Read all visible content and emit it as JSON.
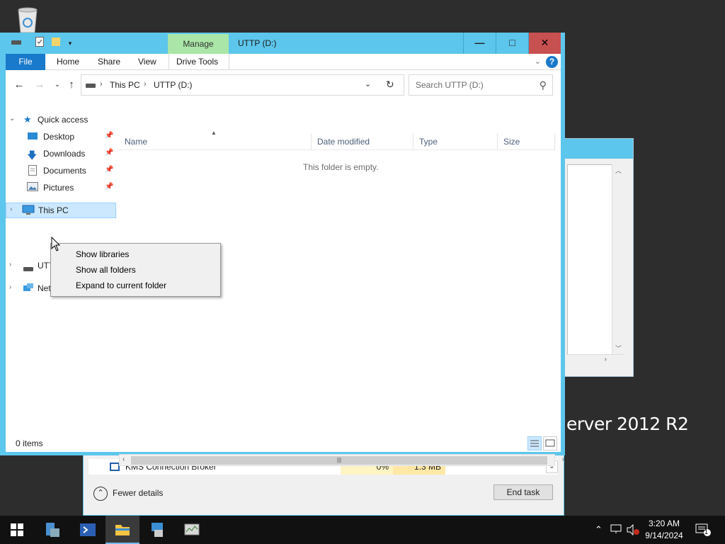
{
  "desktop": {
    "recycle_bin_icon": "recycle-bin-icon",
    "watermark": "erver 2012 R2"
  },
  "explorer": {
    "title": "UTTP (D:)",
    "manage_tab": "Manage",
    "ribbon_tabs": [
      "File",
      "Home",
      "Share",
      "View",
      "Drive Tools"
    ],
    "breadcrumb": [
      "This PC",
      "UTTP (D:)"
    ],
    "search_placeholder": "Search UTTP (D:)",
    "columns": [
      "Name",
      "Date modified",
      "Type",
      "Size"
    ],
    "empty_message": "This folder is empty.",
    "status": "0 items",
    "nav_pane": {
      "quick_access": "Quick access",
      "quick_items": [
        "Desktop",
        "Downloads",
        "Documents",
        "Pictures"
      ],
      "this_pc": "This PC",
      "drive": "UTTP (D:)",
      "network": "Network"
    }
  },
  "context_menu": {
    "items": [
      "Show libraries",
      "Show all folders",
      "Expand to current folder"
    ]
  },
  "task_manager": {
    "process_name": "KMS Connection Broker",
    "cpu": "0%",
    "memory": "1.3 MB",
    "fewer_details": "Fewer details",
    "end_task": "End task"
  },
  "taskbar": {
    "time": "3:20 AM",
    "date": "9/14/2024",
    "notification_count": "1"
  },
  "colors": {
    "accent": "#5dc6ec",
    "file_tab": "#1979ca",
    "manage_tab": "#aae6a7",
    "close_button": "#c75050",
    "selection": "#cce8ff"
  }
}
